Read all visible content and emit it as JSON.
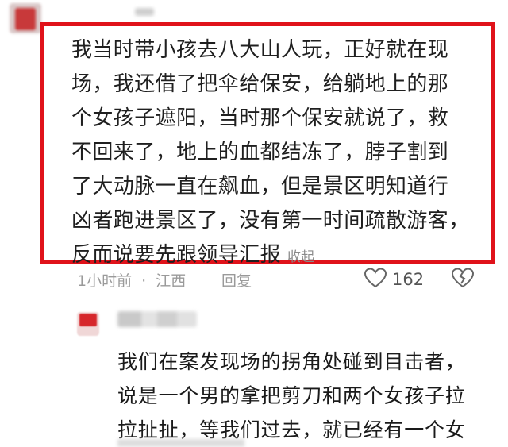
{
  "comment1": {
    "lines": [
      "我当时带小孩去八大山人玩，正好就在现",
      "场，我还借了把伞给保安，给躺地上的那",
      "个女孩子遮阳，当时那个保安就说了，救",
      "不回来了，地上的血都结冻了，脖子割到",
      "了大动脉一直在飙血，但是景区明知道行",
      "凶者跑进景区了，没有第一时间疏散游客，",
      "反而说要先跟领导汇报"
    ],
    "collapse_label": "收起",
    "time": "1小时前",
    "separator": "·",
    "location": "江西",
    "reply_label": "回复",
    "like_count": "162"
  },
  "comment2": {
    "lines": [
      "我们在案发现场的拐角处碰到目击者，",
      "说是一个男的拿把剪刀和两个女孩子拉",
      "拉扯扯，等我们过去，就已经有一个女"
    ]
  },
  "colors": {
    "highlight_border": "#e0121a",
    "meta_text": "#9a9a9a"
  },
  "icons": {
    "like": "heart-outline-icon",
    "dislike": "broken-heart-icon"
  }
}
